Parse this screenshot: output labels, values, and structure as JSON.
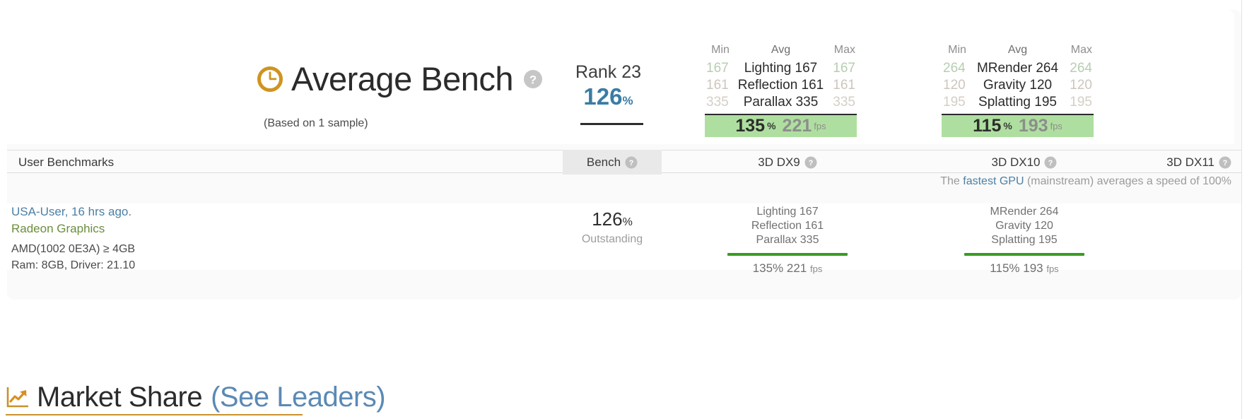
{
  "hero": {
    "clock_icon": "clock-icon",
    "title": "Average Bench",
    "help_icon": "help-icon",
    "sample_note": "(Based on 1 sample)",
    "rank_label": "Rank 23",
    "rank_score": "126",
    "rank_unit": "%"
  },
  "stat_groups": [
    {
      "id": "dx9",
      "head": {
        "min": "Min",
        "avg": "Avg",
        "max": "Max"
      },
      "rows": [
        {
          "min": "167",
          "avg": "Lighting 167",
          "max": "167"
        },
        {
          "min": "161",
          "avg": "Reflection 161",
          "max": "161"
        },
        {
          "min": "335",
          "avg": "Parallax 335",
          "max": "335"
        }
      ],
      "total": {
        "score": "135",
        "unit": "%",
        "fps": "221",
        "fps_unit": "fps"
      }
    },
    {
      "id": "dx10",
      "head": {
        "min": "Min",
        "avg": "Avg",
        "max": "Max"
      },
      "rows": [
        {
          "min": "264",
          "avg": "MRender 264",
          "max": "264"
        },
        {
          "min": "120",
          "avg": "Gravity 120",
          "max": "120"
        },
        {
          "min": "195",
          "avg": "Splatting 195",
          "max": "195"
        }
      ],
      "total": {
        "score": "115",
        "unit": "%",
        "fps": "193",
        "fps_unit": "fps"
      }
    }
  ],
  "table": {
    "headers": {
      "user_benchmarks": "User Benchmarks",
      "bench": "Bench",
      "dx9": "3D DX9",
      "dx10": "3D DX10",
      "dx11": "3D DX11"
    },
    "fastest_note": {
      "prefix": "The ",
      "link": "fastest GPU",
      "suffix": " (mainstream) averages a speed of 100%"
    },
    "row": {
      "user": "USA-User, 16 hrs ago.",
      "gpu": "Radeon Graphics",
      "spec_line1": "AMD(1002 0E3A) ≥ 4GB",
      "spec_line2": "Ram: 8GB, Driver: 21.10",
      "bench_score": "126",
      "bench_unit": "%",
      "bench_label": "Outstanding",
      "dx9": {
        "line1": "Lighting 167",
        "line2": "Reflection 161",
        "line3": "Parallax 335",
        "total": "135% 221",
        "total_unit": "fps",
        "bar_color": "#3a9b20"
      },
      "dx10": {
        "line1": "MRender 264",
        "line2": "Gravity 120",
        "line3": "Splatting 195",
        "total": "115% 193",
        "total_unit": "fps",
        "bar_color": "#3a9b20"
      }
    }
  },
  "market_share": {
    "icon": "trend-chart-icon",
    "title": "Market Share",
    "link": "(See Leaders)"
  },
  "colors": {
    "accent_blue": "#4a7fa5",
    "green_bar": "#3a9b20",
    "green_box": "#afdfa0",
    "gold": "#c9912e"
  }
}
